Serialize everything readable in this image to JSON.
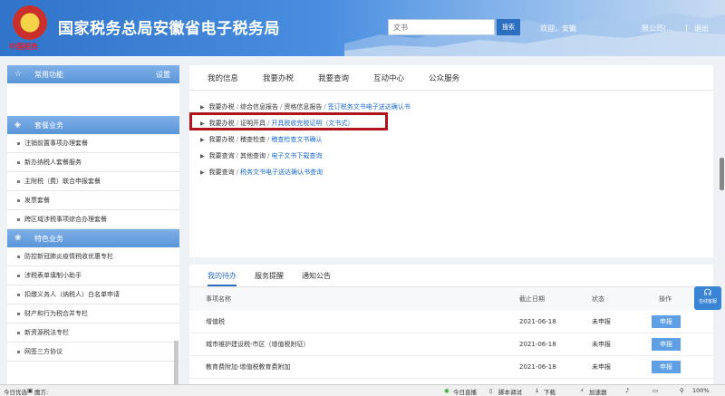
{
  "header": {
    "emblem_caption": "中国税务",
    "title": "国家税务总局安徽省电子税务局",
    "search_placeholder": "文书",
    "search_button": "搜索",
    "welcome": "欢迎，安徽",
    "company": "限公司(...",
    "separator": "|",
    "logout": "退出"
  },
  "sidebar": {
    "common": {
      "label": "常用功能",
      "settings": "设置"
    },
    "package": {
      "label": "套餐业务",
      "items": [
        "注销前置事项办理套餐",
        "新办纳税人套餐服务",
        "主附税（费）联合申报套餐",
        "发票套餐",
        "跨区域涉税事项综合办理套餐"
      ]
    },
    "special": {
      "label": "特色业务",
      "items": [
        "防控新冠肺炎疫情税收优惠专栏",
        "涉税表单填制小助手",
        "扣缴义务人（纳税人）白名单申请",
        "财产和行为税合并专栏",
        "新资源税法专栏",
        "网签三方协议"
      ]
    }
  },
  "top_tabs": [
    "我的信息",
    "我要办税",
    "我要查询",
    "互动中心",
    "公众服务"
  ],
  "links": [
    {
      "p1": "我要办税",
      "p2": "综合信息报告",
      "p3": "资格信息报告",
      "leaf": "签订税务文书电子送达确认书"
    },
    {
      "p1": "我要办税",
      "p2": "证明开具",
      "leaf": "开具税收完税证明（文书式）"
    },
    {
      "p1": "我要办税",
      "p2": "稽查检查",
      "leaf": "稽查检查文书确认"
    },
    {
      "p1": "我要查询",
      "p2": "其他查询",
      "leaf": "电子文书下载查询"
    },
    {
      "p1": "我要查询",
      "leaf": "税务文书电子送达确认书查询"
    }
  ],
  "bottom_tabs": [
    "我的待办",
    "服务提醒",
    "通知公告"
  ],
  "todo": {
    "headers": [
      "事项名称",
      "截止日期",
      "状态",
      "操作"
    ],
    "rows": [
      {
        "name": "增值税",
        "date": "2021-06-18",
        "status": "未申报",
        "action": "申报"
      },
      {
        "name": "城市维护建设税-市区（增值税附征）",
        "date": "2021-06-18",
        "status": "未申报",
        "action": "申报"
      },
      {
        "name": "教育费附加-增值税教育费附加",
        "date": "2021-06-18",
        "status": "未申报",
        "action": "申报"
      }
    ]
  },
  "float_button": "在线客服",
  "statusbar": {
    "left1": "今日优选",
    "left2": "魔方:",
    "items": [
      "今日直播",
      "脚本调试",
      "下载",
      "加速器",
      "100%"
    ]
  }
}
